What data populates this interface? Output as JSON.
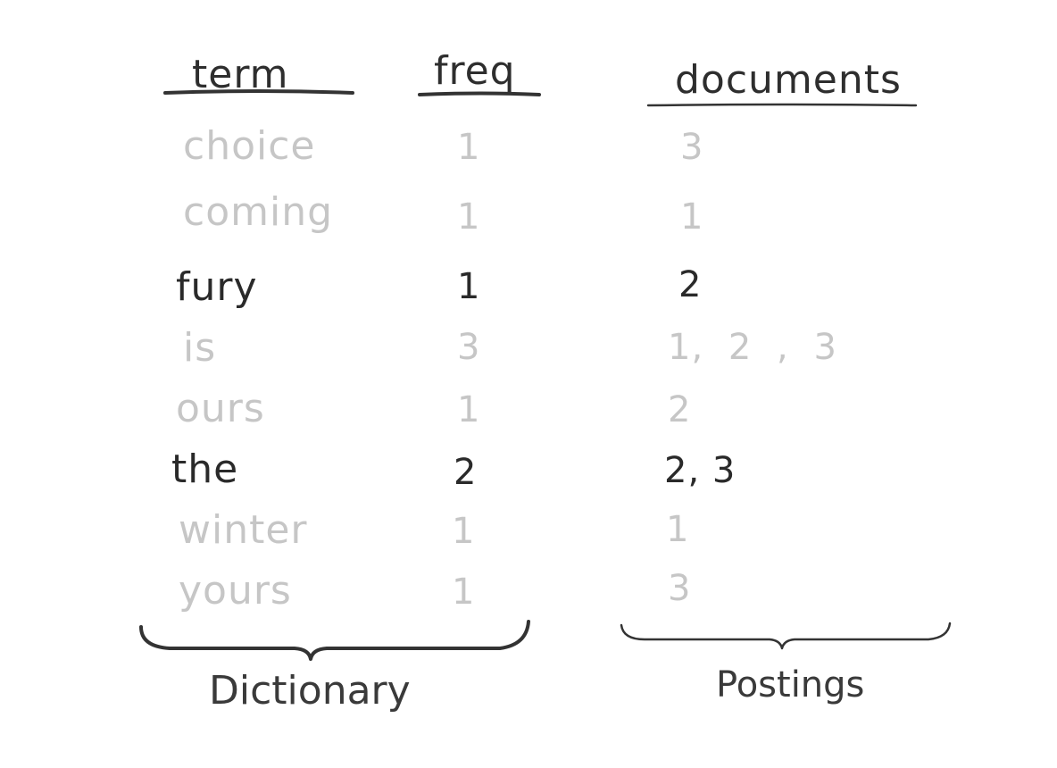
{
  "headers": {
    "term": "term",
    "freq": "freq",
    "documents": "documents"
  },
  "rows": [
    {
      "term": "choice",
      "freq": "1",
      "documents": "3",
      "highlight": false
    },
    {
      "term": "coming",
      "freq": "1",
      "documents": "1",
      "highlight": false
    },
    {
      "term": "fury",
      "freq": "1",
      "documents": "2",
      "highlight": true
    },
    {
      "term": "is",
      "freq": "3",
      "documents": "1, 2 , 3",
      "highlight": false
    },
    {
      "term": "ours",
      "freq": "1",
      "documents": "2",
      "highlight": false
    },
    {
      "term": "the",
      "freq": "2",
      "documents": "2, 3",
      "highlight": true
    },
    {
      "term": "winter",
      "freq": "1",
      "documents": "1",
      "highlight": false
    },
    {
      "term": "yours",
      "freq": "1",
      "documents": "3",
      "highlight": false
    }
  ],
  "labels": {
    "dictionary": "Dictionary",
    "postings": "Postings"
  },
  "colors": {
    "ink": "#2a2a2a",
    "faded": "#c6c6c6"
  }
}
